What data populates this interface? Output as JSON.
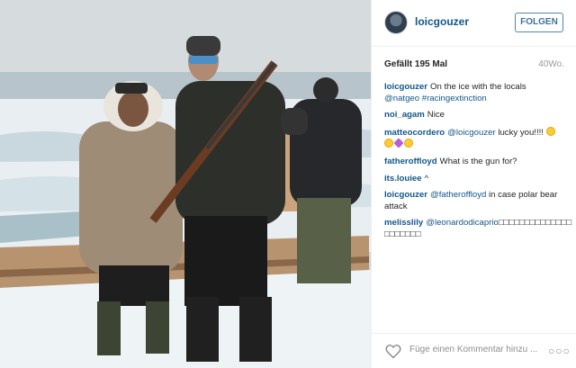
{
  "post": {
    "username": "loicgouzer",
    "follow_label": "FOLGEN",
    "likes": "Gefällt 195 Mal",
    "age": "40Wo."
  },
  "comments": [
    {
      "user": "loicgouzer",
      "text": "On the ice with the locals",
      "mentions": "@natgeo #racingextinction"
    },
    {
      "user": "noi_agam",
      "text": "Nice"
    },
    {
      "user": "matteocordero",
      "mention": "@loicgouzer",
      "text": "lucky you!!!!"
    },
    {
      "user": "fatheroffloyd",
      "text": "What is the gun for?"
    },
    {
      "user": "its.louiee",
      "text": "^"
    },
    {
      "user": "loicgouzer",
      "mention": "@fatheroffloyd",
      "text": "in case polar bear attack"
    },
    {
      "user": "melisslily",
      "mention": "@leonardodicaprio",
      "text": "□□□□□□□□□□□□□□□□□□□□□"
    }
  ],
  "footer": {
    "placeholder": "Füge einen Kommentar hinzu ...",
    "more": "○○○"
  },
  "icons": {
    "like": "heart-outline-icon",
    "more": "ellipsis-icon"
  },
  "colors": {
    "username": "#125688",
    "follow_border": "#4c87b5",
    "muted": "#999999"
  }
}
